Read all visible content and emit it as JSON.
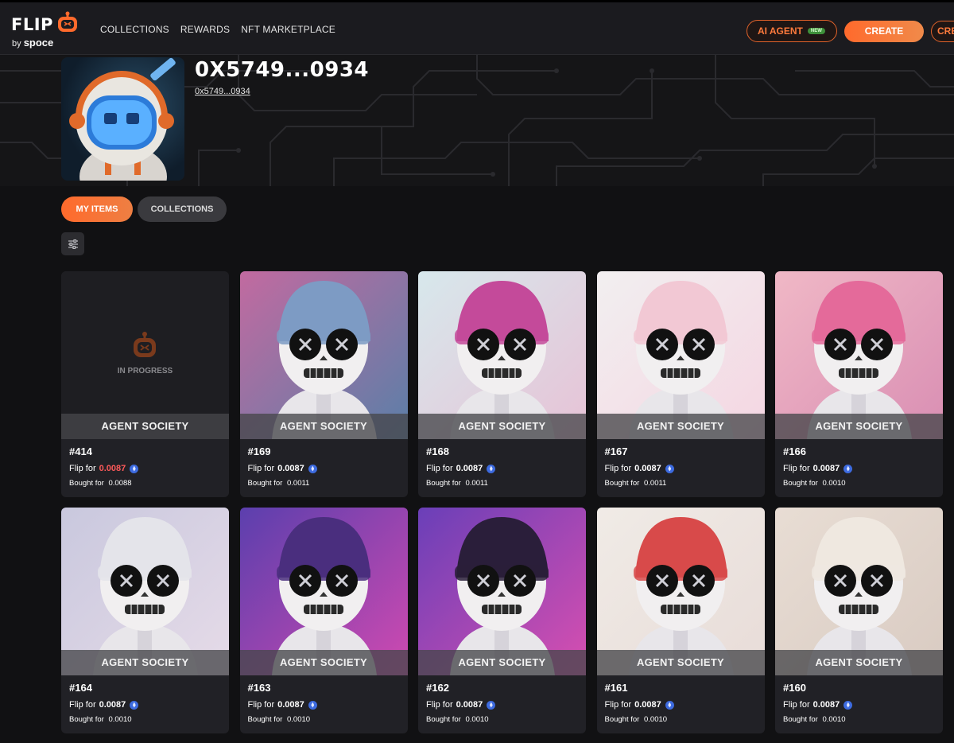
{
  "nav": {
    "logo_word": "FLIP",
    "logo_by": "by",
    "logo_brand": "spoce",
    "links": [
      "COLLECTIONS",
      "REWARDS",
      "NFT MARKETPLACE"
    ],
    "ai_agent": "AI AGENT",
    "new_badge": "NEW",
    "create": "CREATE",
    "create_clipped": "CRE"
  },
  "profile": {
    "title": "0X5749...0934",
    "address": "0x5749...0934"
  },
  "tabs": {
    "my_items": "MY ITEMS",
    "collections": "COLLECTIONS"
  },
  "labels": {
    "flip_for": "Flip for",
    "bought_for": "Bought for"
  },
  "colors": {
    "accent": "#ff6a2c",
    "flip_highlight": "#ff5a5a"
  },
  "cards": [
    {
      "collection": "AGENT SOCIETY",
      "number": "#414",
      "flip": "0.0087",
      "bought": "0.0088",
      "status": "IN PROGRESS",
      "bg": [
        "#1e1e22",
        "#1e1e22"
      ],
      "hat": "#000",
      "highlight": true
    },
    {
      "collection": "AGENT SOCIETY",
      "number": "#169",
      "flip": "0.0087",
      "bought": "0.0011",
      "bg": [
        "#c26aa0",
        "#5a7fa8"
      ],
      "hat": "#7d9bc4",
      "highlight": false
    },
    {
      "collection": "AGENT SOCIETY",
      "number": "#168",
      "flip": "0.0087",
      "bought": "0.0011",
      "bg": [
        "#d7e8ec",
        "#e7c2d6"
      ],
      "hat": "#c44a9a",
      "highlight": false
    },
    {
      "collection": "AGENT SOCIETY",
      "number": "#167",
      "flip": "0.0087",
      "bought": "0.0011",
      "bg": [
        "#f2eff0",
        "#f4d6e2"
      ],
      "hat": "#f2c8d4",
      "highlight": false
    },
    {
      "collection": "AGENT SOCIETY",
      "number": "#166",
      "flip": "0.0087",
      "bought": "0.0010",
      "bg": [
        "#f0b8c6",
        "#d98eb3"
      ],
      "hat": "#e46a9a",
      "highlight": false
    },
    {
      "collection": "AGENT SOCIETY",
      "number": "#164",
      "flip": "0.0087",
      "bought": "0.0010",
      "bg": [
        "#c9c8de",
        "#e6dbe8"
      ],
      "hat": "#e4e4ea",
      "highlight": false
    },
    {
      "collection": "AGENT SOCIETY",
      "number": "#163",
      "flip": "0.0087",
      "bought": "0.0010",
      "bg": [
        "#5b3fae",
        "#d04ab0"
      ],
      "hat": "#4a2e7e",
      "highlight": false
    },
    {
      "collection": "AGENT SOCIETY",
      "number": "#162",
      "flip": "0.0087",
      "bought": "0.0010",
      "bg": [
        "#6a3fb8",
        "#d84fb0"
      ],
      "hat": "#2a1e3a",
      "highlight": false
    },
    {
      "collection": "AGENT SOCIETY",
      "number": "#161",
      "flip": "0.0087",
      "bought": "0.0010",
      "bg": [
        "#f0ebe6",
        "#e8dcd8"
      ],
      "hat": "#d84a4a",
      "highlight": false
    },
    {
      "collection": "AGENT SOCIETY",
      "number": "#160",
      "flip": "0.0087",
      "bought": "0.0010",
      "bg": [
        "#e8ddd4",
        "#d9cbc2"
      ],
      "hat": "#efe8e0",
      "highlight": false
    }
  ]
}
